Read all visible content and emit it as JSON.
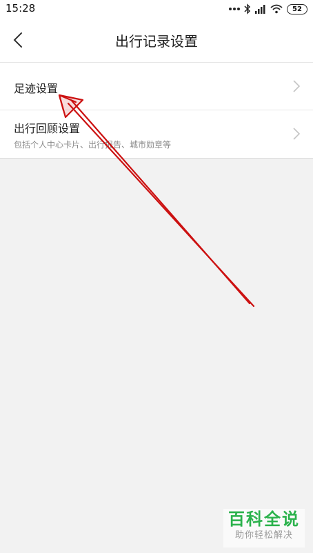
{
  "status_bar": {
    "time": "15:28",
    "battery": "52"
  },
  "header": {
    "title": "出行记录设置"
  },
  "settings_list": [
    {
      "title": "足迹设置",
      "subtitle": ""
    },
    {
      "title": "出行回顾设置",
      "subtitle": "包括个人中心卡片、出行报告、城市勋章等"
    }
  ],
  "watermark": {
    "title": "百科全说",
    "subtitle": "助你轻松解决"
  },
  "colors": {
    "annotation_arrow": "#cc1111",
    "watermark_green": "#2bb24c",
    "background": "#f2f2f2"
  }
}
